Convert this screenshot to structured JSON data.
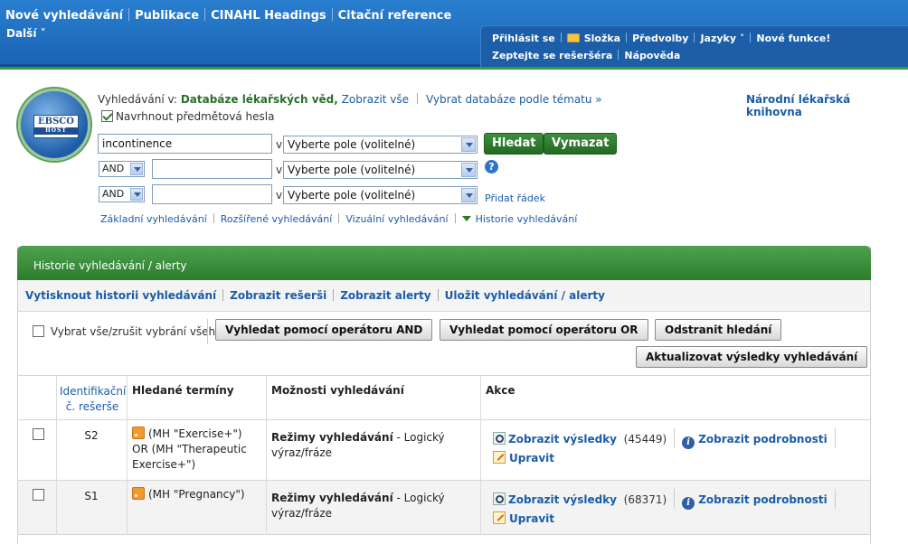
{
  "topnav": {
    "items": [
      "Nové vyhledávání",
      "Publikace",
      "CINAHL Headings",
      "Citační reference"
    ],
    "more": "Další"
  },
  "utility": {
    "row1": [
      "Přihlásit se",
      "Složka",
      "Předvolby",
      "Jazyky",
      "Nové funkce!"
    ],
    "row2": [
      "Zeptejte se rešeršéra",
      "Nápověda"
    ]
  },
  "search": {
    "logo_text": "EBSCO",
    "logo_sub": "HOST",
    "searching_in_label": "Vyhledávání v:",
    "database": "Databáze lékařských věd,",
    "show_all": "Zobrazit vše",
    "choose_db": "Vybrat databáze podle tématu »",
    "library": "Národní lékařská knihovna",
    "suggest_terms": "Navrhnout předmětová hesla",
    "field_placeholder": "Vyberte pole (volitelné)",
    "v_label": "v",
    "query1": "incontinence",
    "operator2": "AND",
    "operator3": "AND",
    "search_button": "Hledat",
    "clear_button": "Vymazat",
    "help_symbol": "?",
    "add_row": "Přidat řádek",
    "links": [
      "Základní vyhledávání",
      "Rozšířené vyhledávání",
      "Vizuální vyhledávání",
      "Historie vyhledávání"
    ]
  },
  "history": {
    "title": "Historie vyhledávání / alerty",
    "toolbar": [
      "Vytisknout historii vyhledávání",
      "Zobrazit rešerši",
      "Zobrazit alerty",
      "Uložit vyhledávání / alerty"
    ],
    "select_all": "Vybrat vše/zrušit vybrání všeho",
    "btn_and": "Vyhledat pomocí operátoru AND",
    "btn_or": "Vyhledat pomocí operátoru OR",
    "btn_remove": "Odstranit hledání",
    "btn_update": "Aktualizovat výsledky vyhledávání",
    "columns": {
      "id": "Identifikační č. rešerše",
      "terms": "Hledané termíny",
      "options": "Možnosti vyhledávání",
      "actions": "Akce"
    },
    "rows": [
      {
        "id": "S2",
        "terms": "(MH \"Exercise+\") OR (MH \"Therapeutic Exercise+\")",
        "mode_label": "Režimy vyhledávání",
        "mode_value": " - Logický výraz/fráze",
        "view_results": "Zobrazit výsledky",
        "count": "(45449)",
        "view_details": "Zobrazit podrobnosti",
        "edit": "Upravit"
      },
      {
        "id": "S1",
        "terms": "(MH \"Pregnancy\")",
        "mode_label": "Režimy vyhledávání",
        "mode_value": " - Logický výraz/fráze",
        "view_results": "Zobrazit výsledky",
        "count": "(68371)",
        "view_details": "Zobrazit podrobnosti",
        "edit": "Upravit"
      }
    ]
  },
  "colors": {
    "topbar": "#1a64b3",
    "green_accent": "#2c7d2c",
    "link": "#1b5ca8"
  }
}
